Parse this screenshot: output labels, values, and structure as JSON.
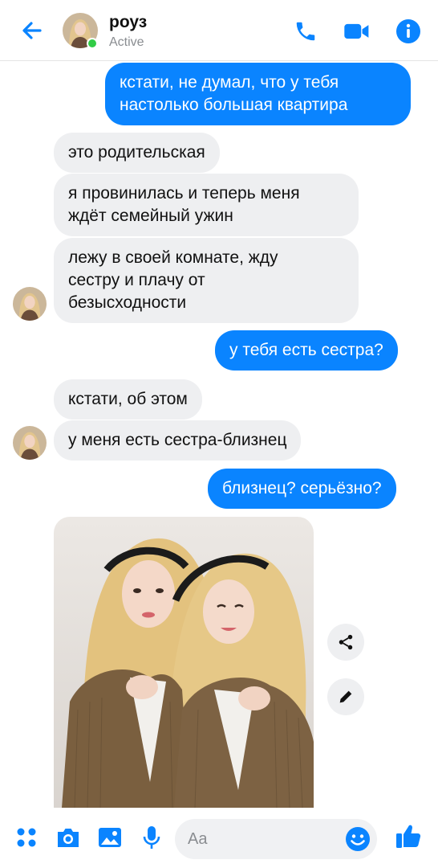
{
  "header": {
    "contact_name": "роуз",
    "status": "Active",
    "icons": [
      "back-arrow-icon",
      "phone-icon",
      "video-camera-icon",
      "info-icon"
    ]
  },
  "messages": [
    {
      "side": "out",
      "text": "кстати, не думал, что у тебя\nнастолько большая квартира"
    },
    {
      "side": "in",
      "text": "это родительская"
    },
    {
      "side": "in",
      "text": "я провинилась и теперь меня\nждёт семейный ужин"
    },
    {
      "side": "in",
      "text": "лежу в своей комнате, жду\nсестру и плачу от\nбезысходности"
    },
    {
      "side": "out",
      "text": "у тебя есть сестра?"
    },
    {
      "side": "in",
      "text": "кстати, об этом"
    },
    {
      "side": "in",
      "text": "у меня есть сестра-близнец"
    },
    {
      "side": "out",
      "text": "близнец? серьёзно?"
    }
  ],
  "photo": {
    "description_icon": "photo-attachment",
    "side_actions": [
      "share-icon",
      "edit-icon"
    ]
  },
  "composer": {
    "placeholder": "Aa",
    "icons": [
      "apps-icon",
      "camera-icon",
      "gallery-icon",
      "microphone-icon",
      "emoji-icon",
      "thumbs-up-icon"
    ]
  },
  "colors": {
    "accent": "#0a84ff",
    "incoming_bubble": "#eeeff1",
    "online": "#31cc46"
  }
}
